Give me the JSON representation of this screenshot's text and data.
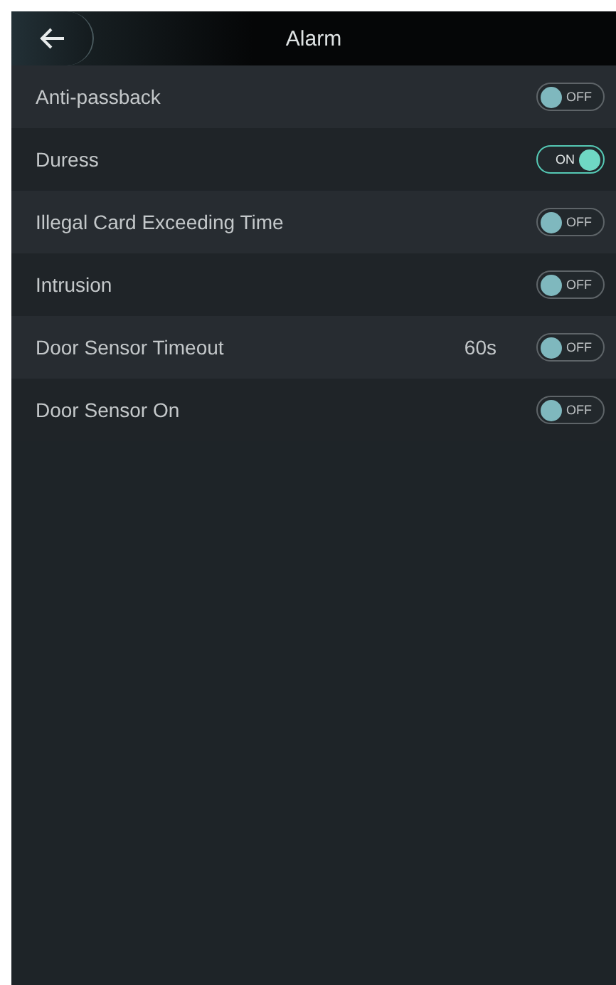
{
  "header": {
    "title": "Alarm"
  },
  "settings": [
    {
      "label": "Anti-passback",
      "on": false,
      "switch_text": "OFF"
    },
    {
      "label": "Duress",
      "on": true,
      "switch_text": "ON"
    },
    {
      "label": "Illegal Card Exceeding Time",
      "on": false,
      "switch_text": "OFF"
    },
    {
      "label": "Intrusion",
      "on": false,
      "switch_text": "OFF"
    },
    {
      "label": "Door Sensor Timeout",
      "value": "60s",
      "on": false,
      "switch_text": "OFF"
    },
    {
      "label": "Door Sensor On",
      "on": false,
      "switch_text": "OFF"
    }
  ]
}
